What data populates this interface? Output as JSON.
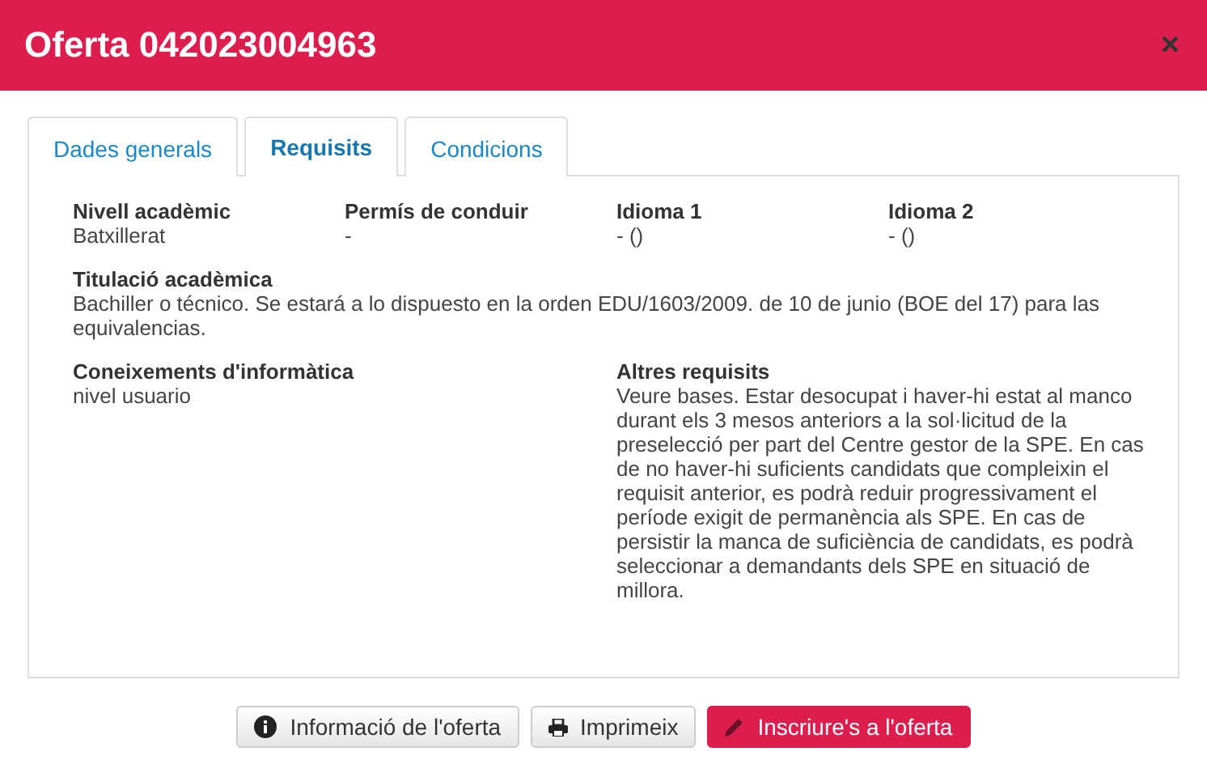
{
  "window": {
    "title": "Oferta 042023004963",
    "close": "×"
  },
  "tabs": [
    {
      "label": "Dades generals",
      "selected": false
    },
    {
      "label": "Requisits",
      "selected": true
    },
    {
      "label": "Condicions",
      "selected": false
    }
  ],
  "top_fields": [
    {
      "label": "Nivell acadèmic",
      "value": "Batxillerat"
    },
    {
      "label": "Permís de conduir",
      "value": "-"
    },
    {
      "label": "Idioma 1",
      "value": "- ()"
    },
    {
      "label": "Idioma 2",
      "value": "- ()"
    }
  ],
  "degree": {
    "label": "Titulació acadèmica",
    "value": "Bachiller o técnico. Se estará a lo dispuesto en la orden EDU/1603/2009. de 10 de junio (BOE del 17) para las equivalencias."
  },
  "bottom_fields": [
    {
      "label": "Coneixements d'informàtica",
      "value": "nivel usuario"
    },
    {
      "label": "Altres requisits",
      "value": "Veure bases. Estar desocupat i haver-hi estat al manco durant els 3 mesos anteriors a la sol·licitud de la preselecció per part del Centre gestor de la SPE. En cas de no haver-hi suficients candidats que compleixin el requisit anterior, es podrà reduir progressivament el període exigit de permanència als SPE. En cas de persistir la manca de suficiència de candidats, es podrà seleccionar a demandants dels SPE en situació de millora."
    }
  ],
  "buttons": [
    {
      "label": "Informació de l'oferta",
      "kind": "info"
    },
    {
      "label": "Imprimeix",
      "kind": "print"
    },
    {
      "label": "Inscriure's a l'oferta",
      "kind": "apply"
    }
  ]
}
